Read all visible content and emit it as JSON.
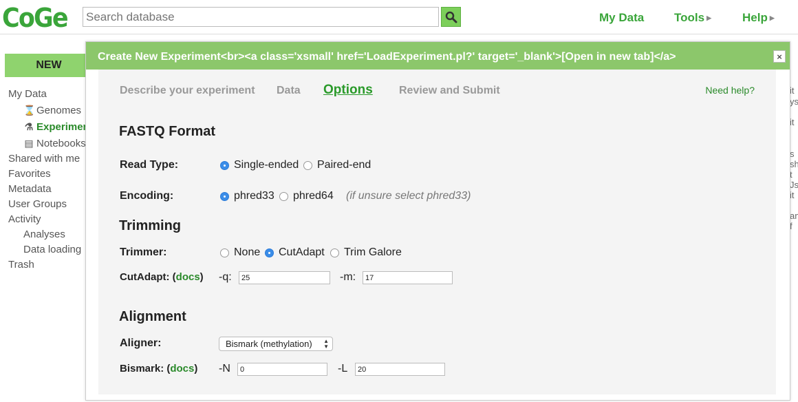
{
  "header": {
    "logo": "CoGe",
    "search_placeholder": "Search database",
    "nav": {
      "my_data": "My Data",
      "tools": "Tools",
      "help": "Help"
    }
  },
  "sidebar": {
    "new_button": "NEW",
    "items": {
      "my_data": "My Data",
      "genomes": "Genomes",
      "experiments": "Experimen",
      "notebooks": "Notebooks",
      "shared": "Shared with me",
      "favorites": "Favorites",
      "metadata": "Metadata",
      "user_groups": "User Groups",
      "activity": "Activity",
      "analyses": "Analyses",
      "data_loading": "Data loading",
      "trash": "Trash"
    }
  },
  "background_fragments": [
    "it",
    "ys",
    "it",
    "s",
    "sh",
    "t",
    "Js",
    "it",
    "an",
    "f"
  ],
  "dialog": {
    "title": "Create New Experiment<br><a class='xsmall' href='LoadExperiment.pl?' target='_blank'>[Open in new tab]</a>",
    "close": "×",
    "tabs": {
      "describe": "Describe your experiment",
      "data": "Data",
      "options": "Options",
      "review": "Review and Submit"
    },
    "help": "Need help?",
    "fastq": {
      "heading": "FASTQ Format",
      "read_type_label": "Read Type:",
      "single": "Single-ended",
      "paired": "Paired-end",
      "encoding_label": "Encoding:",
      "phred33": "phred33",
      "phred64": "phred64",
      "encoding_hint": "(if unsure select phred33)"
    },
    "trimming": {
      "heading": "Trimming",
      "trimmer_label": "Trimmer:",
      "none": "None",
      "cutadapt": "CutAdapt",
      "trim_galore": "Trim Galore",
      "cutadapt_label": "CutAdapt: (",
      "docs": "docs",
      "close_paren": ")",
      "q_label": "-q:",
      "q_value": "25",
      "m_label": "-m:",
      "m_value": "17"
    },
    "alignment": {
      "heading": "Alignment",
      "aligner_label": "Aligner:",
      "aligner_value": "Bismark (methylation)",
      "bismark_label": "Bismark: (",
      "docs": "docs",
      "close_paren": ")",
      "n_label": "-N",
      "n_value": "0",
      "l_label": "-L",
      "l_value": "20"
    }
  }
}
